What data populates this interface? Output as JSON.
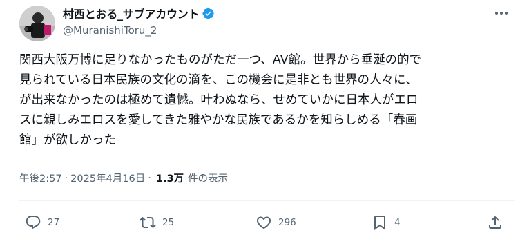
{
  "author": {
    "display_name": "村西とおる_サブアカウント",
    "handle": "@MuranishiToru_2",
    "avatar_icon": "person-photo-icon",
    "verified_color": "#1d9bf0"
  },
  "tweet": {
    "lines": [
      "関西大阪万博に足りなかったものがただ一つ、AV館。世界から垂涎の的で",
      "見られている日本民族の文化の滴を、この機会に是非とも世界の人々に、",
      "が出来なかったのは極めて遺憾。叶わぬなら、せめていかに日本人がエロ",
      "スに親しみエロスを愛してきた雅やかな民族であるかを知らしめる「春画",
      "館」が欲しかった"
    ],
    "time": "午後2:57",
    "separator1": "·",
    "date": "2025年4月16日",
    "separator2": "·",
    "views_count": "1.3万",
    "views_label": "件の表示"
  },
  "actions": {
    "reply_count": "27",
    "retweet_count": "25",
    "like_count": "296",
    "bookmark_count": "4"
  },
  "colors": {
    "text_primary": "#0f1419",
    "text_secondary": "#536471",
    "divider": "#eff3f4"
  }
}
